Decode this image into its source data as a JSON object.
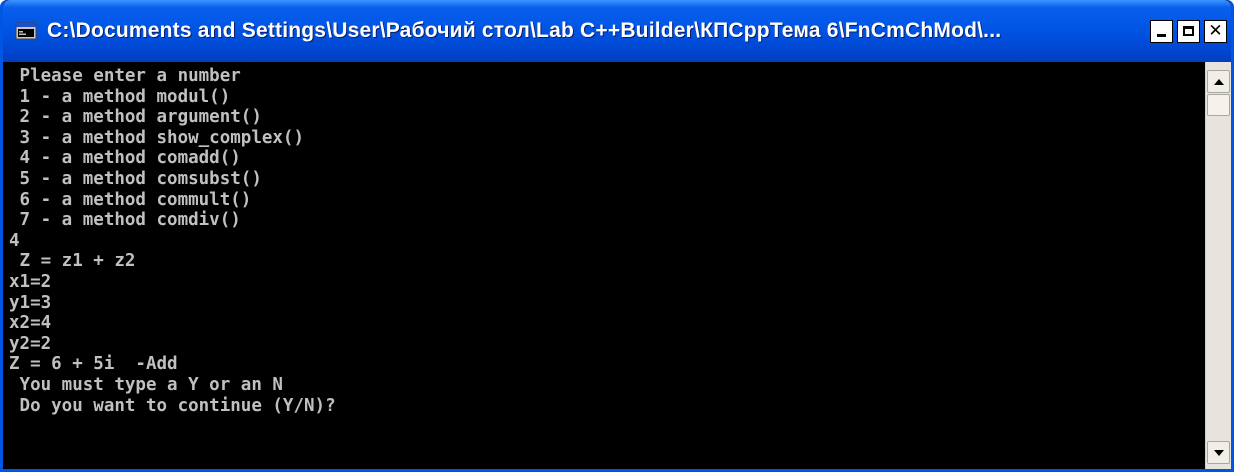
{
  "window": {
    "title": "C:\\Documents and Settings\\User\\Рабочий стол\\Lab C++Builder\\КПСррТема 6\\FnCmChMod\\...",
    "icon": "console-app-icon",
    "controls": {
      "minimize_icon": "minimize-icon",
      "maximize_icon": "maximize-icon",
      "close_icon": "close-icon"
    },
    "colors": {
      "titlebar": "#0055e5",
      "console_bg": "#000000",
      "console_text": "#c0c0c0"
    }
  },
  "console": {
    "lines": [
      " Please enter a number",
      " 1 - a method modul()",
      " 2 - a method argument()",
      " 3 - a method show_complex()",
      " 4 - a method comadd()",
      " 5 - a method comsubst()",
      " 6 - a method commult()",
      " 7 - a method comdiv()",
      "4",
      " Z = z1 + z2",
      "x1=2",
      "y1=3",
      "x2=4",
      "y2=2",
      "Z = 6 + 5i  -Add",
      " You must type a Y or an N",
      " Do you want to continue (Y/N)?"
    ]
  },
  "scrollbar": {
    "up_icon": "scroll-up-arrow-icon",
    "down_icon": "scroll-down-arrow-icon"
  }
}
